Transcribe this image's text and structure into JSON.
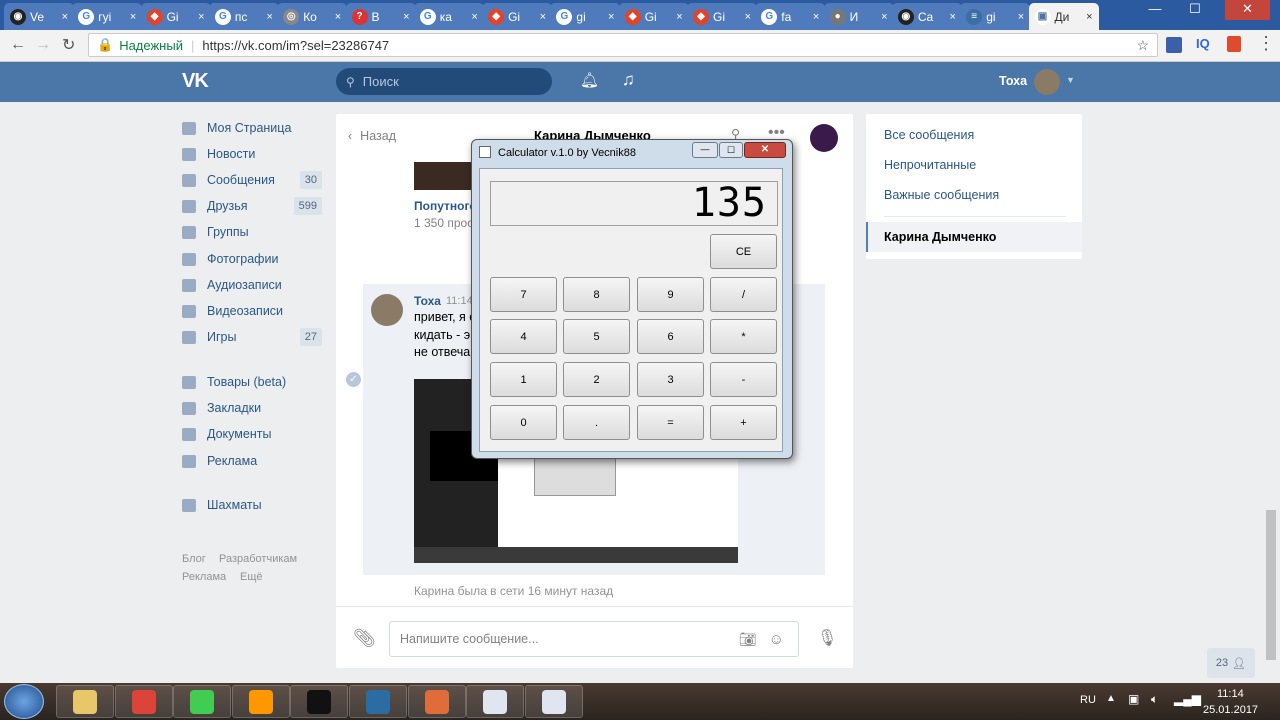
{
  "browser": {
    "tabs": [
      {
        "icon": "github-icon",
        "label": "Ve"
      },
      {
        "icon": "google-icon",
        "label": "гуі"
      },
      {
        "icon": "git-icon",
        "label": "Gi"
      },
      {
        "icon": "google-icon",
        "label": "пс"
      },
      {
        "icon": "globe-icon",
        "label": "Ко"
      },
      {
        "icon": "question-icon",
        "label": "В"
      },
      {
        "icon": "google-icon",
        "label": "ка"
      },
      {
        "icon": "git-icon",
        "label": "Gi"
      },
      {
        "icon": "google-icon",
        "label": "gi"
      },
      {
        "icon": "git-icon",
        "label": "Gi"
      },
      {
        "icon": "git-icon",
        "label": "Gi"
      },
      {
        "icon": "google-icon",
        "label": "fa"
      },
      {
        "icon": "person-icon",
        "label": "И"
      },
      {
        "icon": "github-icon",
        "label": "Ca"
      },
      {
        "icon": "stack-icon",
        "label": "gi"
      },
      {
        "icon": "vk-icon",
        "label": "Ди"
      }
    ],
    "secure_label": "Надежный",
    "url": "https://vk.com/im?sel=23286747"
  },
  "vk": {
    "search_placeholder": "Поиск",
    "user_name": "Тоха",
    "menu": [
      {
        "label": "Моя Страница",
        "icon": "home-icon",
        "count": ""
      },
      {
        "label": "Новости",
        "icon": "news-icon",
        "count": ""
      },
      {
        "label": "Сообщения",
        "icon": "messages-icon",
        "count": "30"
      },
      {
        "label": "Друзья",
        "icon": "friends-icon",
        "count": "599"
      },
      {
        "label": "Группы",
        "icon": "groups-icon",
        "count": ""
      },
      {
        "label": "Фотографии",
        "icon": "camera-icon",
        "count": ""
      },
      {
        "label": "Аудиозаписи",
        "icon": "music-icon",
        "count": ""
      },
      {
        "label": "Видеозаписи",
        "icon": "video-icon",
        "count": ""
      },
      {
        "label": "Игры",
        "icon": "games-icon",
        "count": "27"
      },
      {
        "label": "Товары (beta)",
        "icon": "bag-icon",
        "count": ""
      },
      {
        "label": "Закладки",
        "icon": "star-icon",
        "count": ""
      },
      {
        "label": "Документы",
        "icon": "doc-icon",
        "count": ""
      },
      {
        "label": "Реклама",
        "icon": "ads-icon",
        "count": ""
      },
      {
        "label": "Шахматы",
        "icon": "chess-icon",
        "count": ""
      }
    ],
    "footer": [
      "Блог",
      "Разработчикам",
      "Реклама",
      "Ещё"
    ],
    "chat": {
      "back_label": "Назад",
      "peer_name": "Карина Дымченко",
      "post_title": "Попутного",
      "post_views": "1 350 прос",
      "msg_author": "Тоха",
      "msg_time": "11:14",
      "msg_text_1": "привет, я с",
      "msg_text_2": "кидать - э",
      "msg_text_3": "не отвеча",
      "last_seen": "Карина была в сети 16 минут назад",
      "input_placeholder": "Напишите сообщение..."
    },
    "right_menu": [
      "Все сообщения",
      "Непрочитанные",
      "Важные сообщения",
      "Карина Дымченко"
    ],
    "online_count": "23"
  },
  "calculator": {
    "title": "Calculator v.1.0 by Vecnik88",
    "display": "135",
    "ce": "CE",
    "rows": [
      [
        "7",
        "8",
        "9",
        "/"
      ],
      [
        "4",
        "5",
        "6",
        "*"
      ],
      [
        "1",
        "2",
        "3",
        "-"
      ],
      [
        "0",
        ".",
        "=",
        "+"
      ]
    ]
  },
  "taskbar": {
    "lang": "RU",
    "time": "11:14",
    "date": "25.01.2017"
  }
}
